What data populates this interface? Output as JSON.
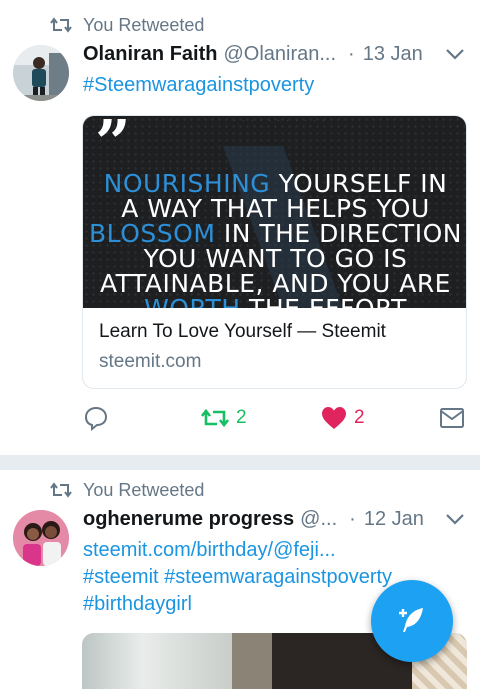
{
  "tweets": [
    {
      "retweet_label": "You Retweeted",
      "name": "Olaniran Faith",
      "handle": "@Olaniran...",
      "separator": "·",
      "date": "13 Jan",
      "hashtag": "#Steemwaragainstpoverty",
      "card": {
        "quote_words": [
          "NOURISHING",
          "YOURSELF IN",
          "A WAY THAT HELPS YOU",
          "BLOSSOM",
          "IN THE DIRECTION",
          "YOU WANT TO GO IS",
          "ATTAINABLE, AND YOU ARE",
          "WORTH",
          "THE EFFORT"
        ],
        "title": "Learn To Love Yourself — Steemit",
        "domain": "steemit.com"
      },
      "actions": {
        "retweets": "2",
        "likes": "2"
      }
    },
    {
      "retweet_label": "You Retweeted",
      "name": "oghenerume progress",
      "handle": "@...",
      "separator": "·",
      "date": "12 Jan",
      "lines": [
        "steemit.com/birthday/@feji...",
        "#steemit #steemwaragainstpoverty",
        "#birthdaygirl"
      ]
    }
  ],
  "colors": {
    "accent": "#1da1f2",
    "link": "#1b95e0",
    "retweet_green": "#17bf63",
    "like_red": "#e0245e",
    "muted": "#657786"
  },
  "icons": {
    "retweet_header": "retweet-icon",
    "chevron": "chevron-down-icon",
    "reply": "reply-icon",
    "retweet": "retweet-icon",
    "like": "heart-icon",
    "dm": "envelope-icon",
    "compose": "compose-feather-icon"
  }
}
